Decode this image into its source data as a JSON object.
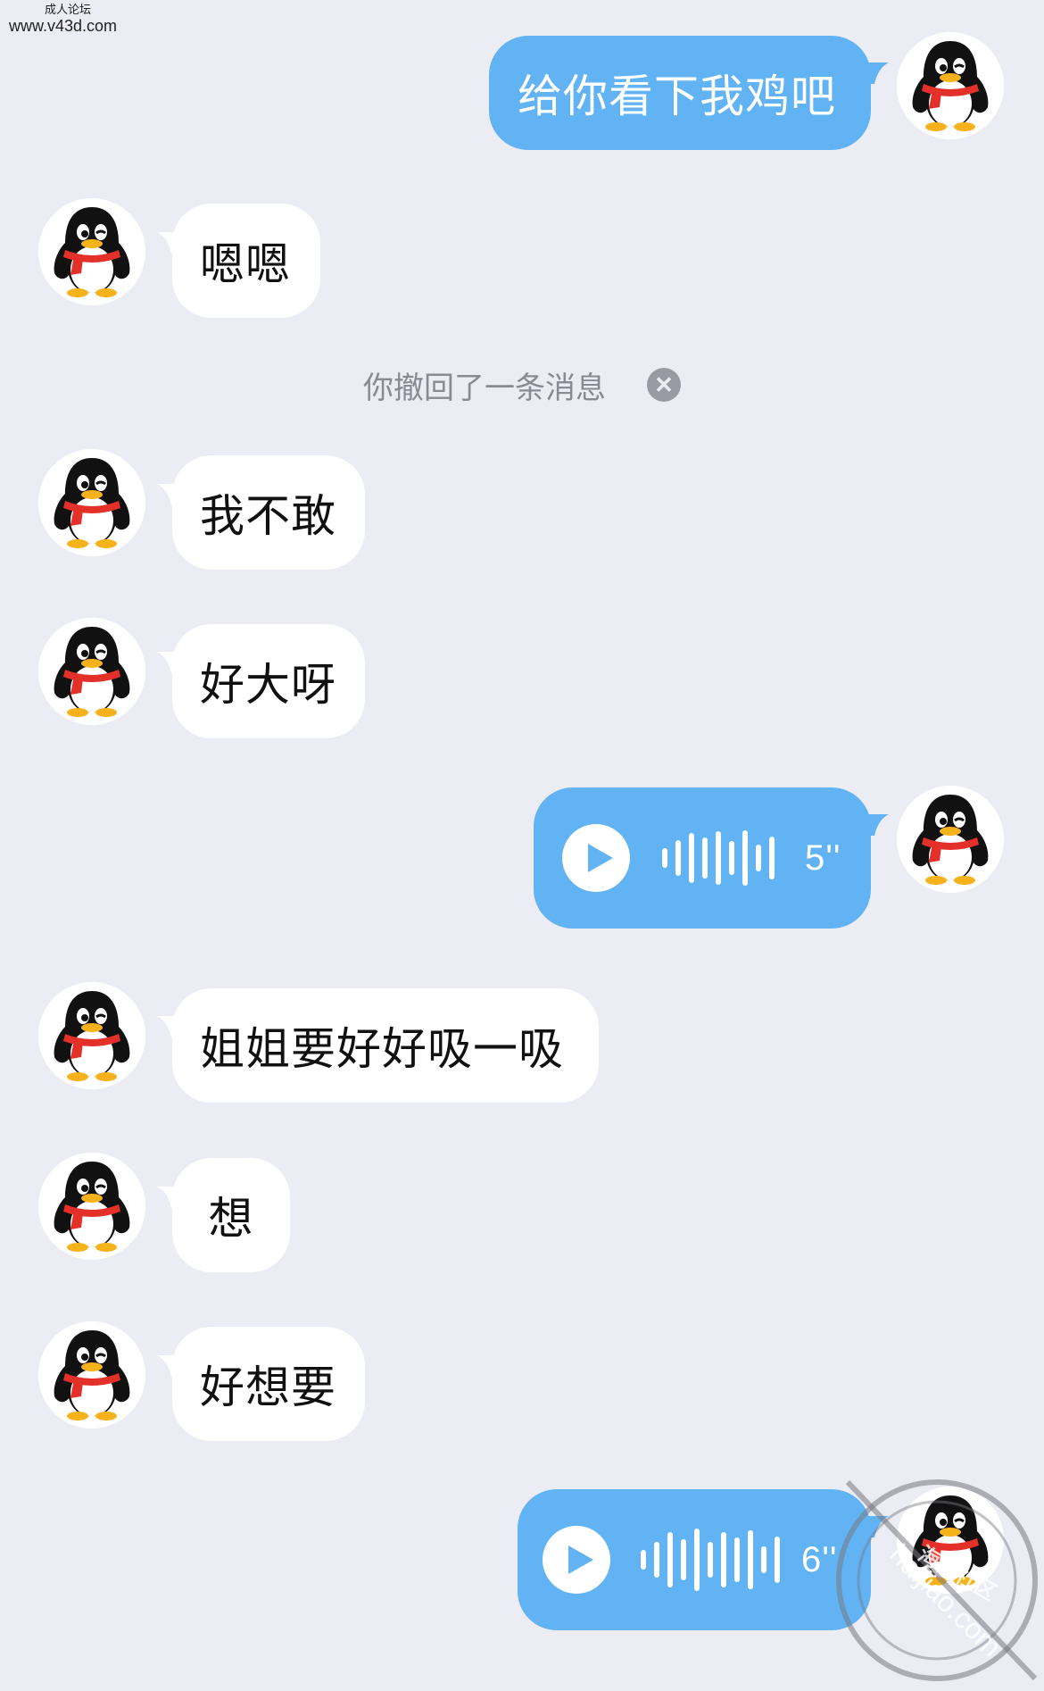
{
  "watermark_top": {
    "small": "成人论坛",
    "site": "www.v43d.com"
  },
  "messages": [
    {
      "side": "out",
      "type": "text",
      "text": "给你看下我鸡吧"
    },
    {
      "side": "in",
      "type": "text",
      "text": "嗯嗯"
    },
    {
      "type": "system",
      "text": "你撤回了一条消息"
    },
    {
      "side": "in",
      "type": "text",
      "text": "我不敢"
    },
    {
      "side": "in",
      "type": "text",
      "text": "好大呀"
    },
    {
      "side": "out",
      "type": "voice",
      "duration": "5''"
    },
    {
      "side": "in",
      "type": "text",
      "text": "姐姐要好好吸一吸"
    },
    {
      "side": "in",
      "type": "text",
      "text": "想"
    },
    {
      "side": "in",
      "type": "text",
      "text": "好想要"
    },
    {
      "side": "out",
      "type": "voice",
      "duration": "6''"
    }
  ],
  "watermark_bottom": {
    "text": "haijiao.com",
    "label": "海角社区"
  },
  "icons": {
    "avatar": "qq-penguin-avatar",
    "play": "play-icon",
    "close": "close-icon",
    "waveform": "waveform-icon"
  },
  "colors": {
    "background": "#ececf4",
    "outgoing_bubble": "#61b3f3",
    "incoming_bubble": "#ffffff"
  }
}
